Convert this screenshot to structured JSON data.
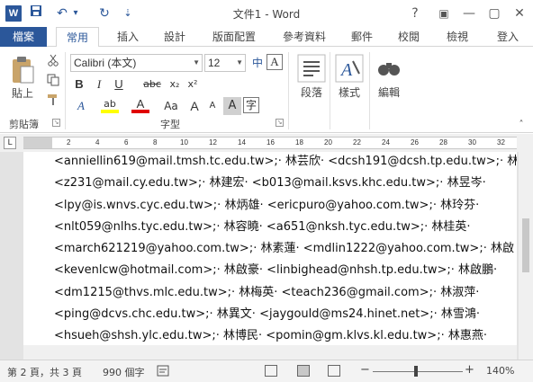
{
  "window": {
    "title": "文件1 - Word",
    "app_icon_letter": "W",
    "help_glyph": "?",
    "ribbon_display_glyph": "▣",
    "minimize_glyph": "—",
    "restore_glyph": "▢",
    "close_glyph": "✕"
  },
  "quick_access": {
    "save_glyph": "💾",
    "undo_glyph": "↶",
    "dropdown_glyph": "▾",
    "redo_glyph": "↻",
    "customize_glyph": "⇣"
  },
  "tabs": {
    "file": "檔案",
    "items": [
      "常用",
      "插入",
      "設計",
      "版面配置",
      "參考資料",
      "郵件",
      "校閱",
      "檢視",
      "登入"
    ]
  },
  "ribbon": {
    "clipboard": {
      "paste_label": "貼上",
      "group_label": "剪貼簿"
    },
    "font": {
      "font_name": "Calibri (本文)",
      "font_size": "12",
      "group_label": "字型",
      "bold": "B",
      "italic": "I",
      "underline": "U",
      "strike": "abc",
      "subscript": "x₂",
      "superscript": "x²",
      "grow": "A",
      "shrink": "A",
      "change_case": "Aa",
      "phonetic": "中",
      "clear_format": "A",
      "text_effect": "A",
      "highlight": "ab",
      "font_color": "A",
      "char_shading": "A",
      "enclose": "字"
    },
    "paragraph": {
      "label": "段落"
    },
    "styles": {
      "label": "樣式"
    },
    "editing": {
      "label": "編輯"
    }
  },
  "ruler": {
    "corner_glyph": "L",
    "numbers": [
      "2",
      "4",
      "6",
      "8",
      "10",
      "12",
      "14",
      "16",
      "18",
      "20",
      "22",
      "24",
      "26",
      "28",
      "30",
      "32"
    ]
  },
  "document": {
    "lines": [
      "<anniellin619@mail.tmsh.tc.edu.tw>;· 林芸欣· <dcsh191@dcsh.tp.edu.tw>;· 林",
      "<z231@mail.cy.edu.tw>;· 林建宏· <b013@mail.ksvs.khc.edu.tw>;· 林昱岑·",
      "<lpy@is.wnvs.cyc.edu.tw>;· 林炳雄· <ericpuro@yahoo.com.tw>;· 林玲芬·",
      "<nlt059@nlhs.tyc.edu.tw>;· 林容曉· <a651@nksh.tyc.edu.tw>;· 林桂英·",
      "<march621219@yahoo.com.tw>;· 林素蓮· <mdlin1222@yahoo.com.tw>;· 林啟",
      "<kevenlcw@hotmail.com>;· 林啟豪· <linbighead@nhsh.tp.edu.tw>;· 林啟鵬·",
      "<dm1215@thvs.mlc.edu.tw>;· 林梅英· <teach236@gmail.com>;· 林淑萍·",
      "<ping@dcvs.chc.edu.tw>;· 林異文· <jaygould@ms24.hinet.net>;· 林雪鴻·",
      "<hsueh@shsh.ylc.edu.tw>;· 林博民· <pomin@gm.klvs.kl.edu.tw>;· 林惠燕·"
    ]
  },
  "status": {
    "page": "第 2 頁，共 3 頁",
    "words": "990 個字",
    "zoom_minus": "−",
    "zoom_plus": "+",
    "zoom": "140%"
  },
  "colors": {
    "accent": "#2b579a",
    "highlight_yellow": "#ffff00",
    "font_red": "#e00000"
  }
}
